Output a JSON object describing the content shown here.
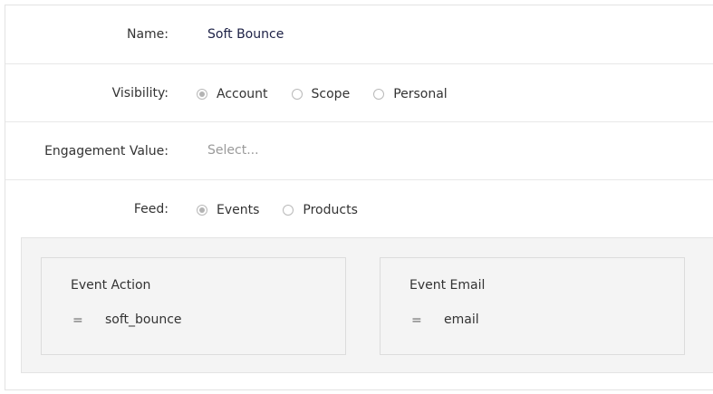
{
  "form": {
    "name_label": "Name:",
    "name_value": "Soft Bounce",
    "visibility_label": "Visibility:",
    "visibility_options": [
      {
        "label": "Account",
        "checked": true
      },
      {
        "label": "Scope",
        "checked": false
      },
      {
        "label": "Personal",
        "checked": false
      }
    ],
    "engagement_label": "Engagement Value:",
    "engagement_placeholder": "Select...",
    "feed_label": "Feed:",
    "feed_options": [
      {
        "label": "Events",
        "checked": true
      },
      {
        "label": "Products",
        "checked": false
      }
    ]
  },
  "conditions": [
    {
      "title": "Event Action",
      "operator": "=",
      "value": "soft_bounce"
    },
    {
      "title": "Event Email",
      "operator": "=",
      "value": "email"
    }
  ]
}
